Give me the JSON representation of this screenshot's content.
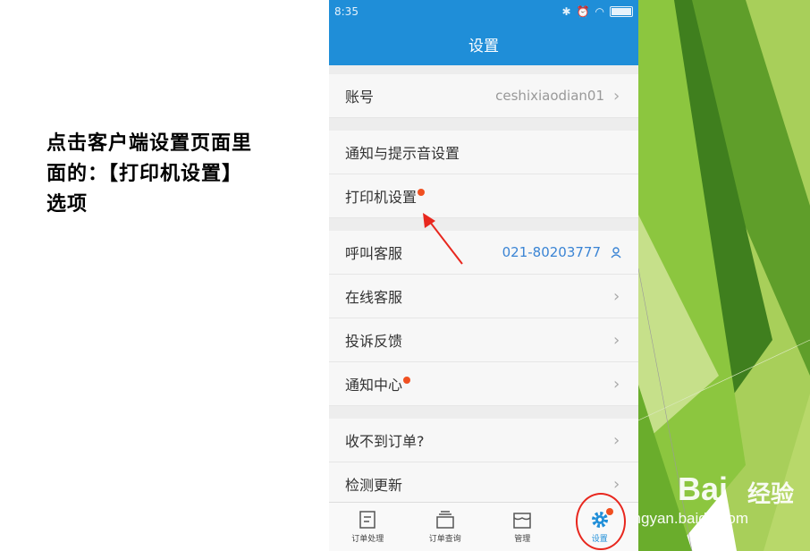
{
  "instruction": "点击客户端设置页面里面的：【打印机设置】选项",
  "status_bar": {
    "time": "8:35"
  },
  "header": {
    "title": "设置"
  },
  "account": {
    "label": "账号",
    "value": "ceshixiaodian01"
  },
  "group2": {
    "notification_sound": "通知与提示音设置",
    "printer_settings": "打印机设置"
  },
  "group3": {
    "call_service": {
      "label": "呼叫客服",
      "value": "021-80203777"
    },
    "online_service": "在线客服",
    "feedback": "投诉反馈",
    "notification_center": "通知中心"
  },
  "group4": {
    "no_orders": "收不到订单?",
    "check_update": "检测更新"
  },
  "tabs": [
    "订单处理",
    "订单查询",
    "管理",
    "设置"
  ],
  "watermark": {
    "logo": "Bai",
    "logo_cn": "经验",
    "url": "jingyan.baidu.com"
  },
  "colors": {
    "primary": "#1f8ed8",
    "badge": "#f05021",
    "annotation": "#e8271e",
    "deco_green": "#7cb82f"
  }
}
